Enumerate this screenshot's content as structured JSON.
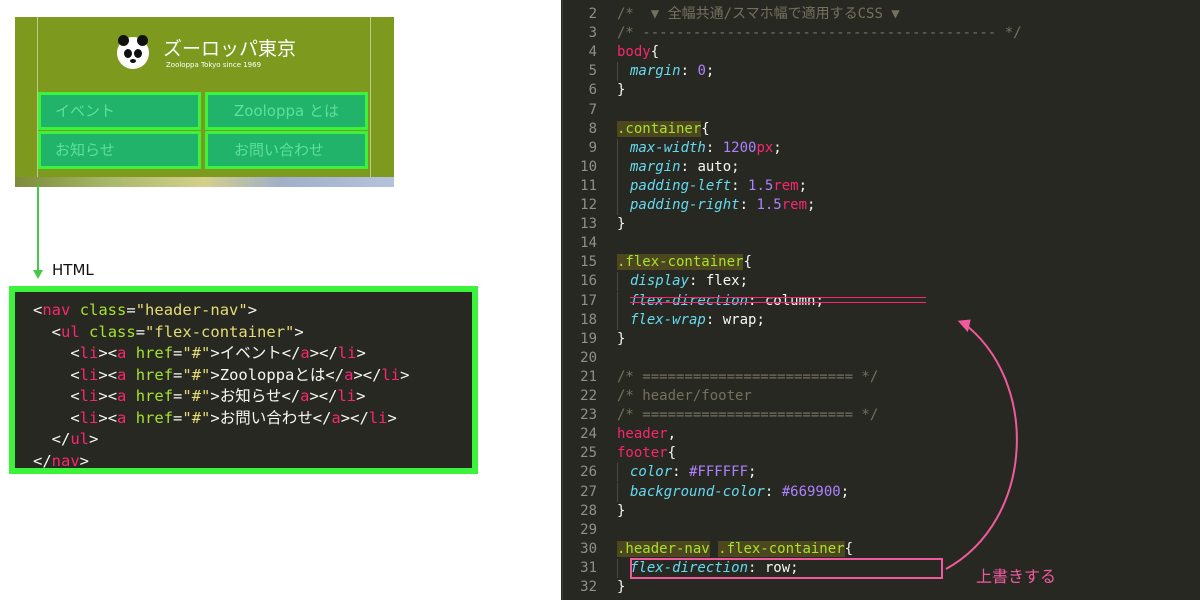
{
  "preview": {
    "site_title": "ズーロッパ東京",
    "site_subtitle": "Zooloppa Tokyo since 1969",
    "nav_items": [
      "イベント",
      "Zooloppa とは",
      "お知らせ",
      "お問い合わせ"
    ]
  },
  "html_label": "HTML",
  "html_code": [
    "<nav class=\"header-nav\">",
    "  <ul class=\"flex-container\">",
    "    <li><a href=\"#\">イベント</a></li>",
    "    <li><a href=\"#\">Zooloppaとは</a></li>",
    "    <li><a href=\"#\">お知らせ</a></li>",
    "    <li><a href=\"#\">お問い合わせ</a></li>",
    "  </ul>",
    "</nav>"
  ],
  "css_lines": [
    {
      "n": "2",
      "text": "/*  ▼ 全幅共通/スマホ幅で適用するCSS ▼"
    },
    {
      "n": "3",
      "text": "/* ------------------------------------------ */"
    },
    {
      "n": "4",
      "text": "body{"
    },
    {
      "n": "5",
      "text": "  margin: 0;"
    },
    {
      "n": "6",
      "text": "}"
    },
    {
      "n": "7",
      "text": ""
    },
    {
      "n": "8",
      "text": ".container{"
    },
    {
      "n": "9",
      "text": "  max-width: 1200px;"
    },
    {
      "n": "10",
      "text": "  margin: auto;"
    },
    {
      "n": "11",
      "text": "  padding-left: 1.5rem;"
    },
    {
      "n": "12",
      "text": "  padding-right: 1.5rem;"
    },
    {
      "n": "13",
      "text": "}"
    },
    {
      "n": "14",
      "text": ""
    },
    {
      "n": "15",
      "text": ".flex-container{"
    },
    {
      "n": "16",
      "text": "  display: flex;"
    },
    {
      "n": "17",
      "text": "  flex-direction: column;"
    },
    {
      "n": "18",
      "text": "  flex-wrap: wrap;"
    },
    {
      "n": "19",
      "text": "}"
    },
    {
      "n": "20",
      "text": ""
    },
    {
      "n": "21",
      "text": "/* ========================= */"
    },
    {
      "n": "22",
      "text": "/* header/footer"
    },
    {
      "n": "23",
      "text": "/* ========================= */"
    },
    {
      "n": "24",
      "text": "header,"
    },
    {
      "n": "25",
      "text": "footer{"
    },
    {
      "n": "26",
      "text": "  color: #FFFFFF;"
    },
    {
      "n": "27",
      "text": "  background-color: #669900;"
    },
    {
      "n": "28",
      "text": "}"
    },
    {
      "n": "29",
      "text": ""
    },
    {
      "n": "30",
      "text": ".header-nav .flex-container{"
    },
    {
      "n": "31",
      "text": "  flex-direction: row;"
    },
    {
      "n": "32",
      "text": "}"
    }
  ],
  "annotation": "上書きする",
  "colors": {
    "nav_cell": "#21b36a",
    "nav_border": "#3df23a",
    "header_bg": "#7d9a1e",
    "editor_bg": "#272822",
    "annotation": "#f05a9c"
  }
}
